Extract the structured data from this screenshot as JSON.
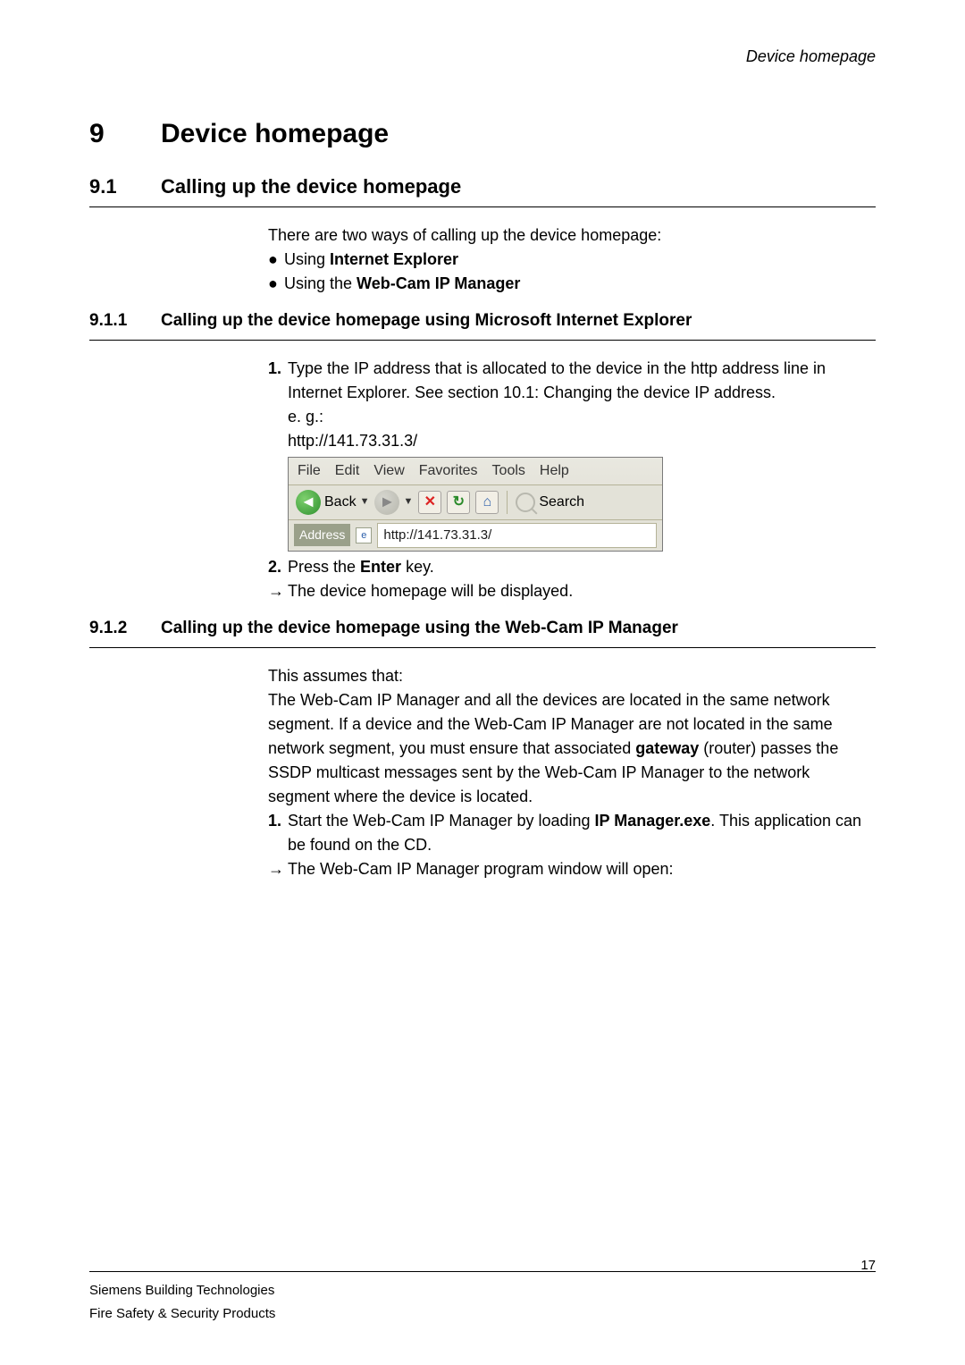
{
  "header": {
    "right": "Device homepage"
  },
  "chapter": {
    "num": "9",
    "title": "Device homepage"
  },
  "s91": {
    "num": "9.1",
    "title": "Calling up the device homepage",
    "intro": "There are two ways of calling up the device homepage:",
    "bullet1_pre": "Using ",
    "bullet1_bold": "Internet Explorer",
    "bullet2_pre": "Using the ",
    "bullet2_bold": "Web-Cam IP Manager"
  },
  "s911": {
    "num": "9.1.1",
    "title": "Calling up the device homepage using Microsoft Internet Explorer",
    "step1": "Type the IP address that is allocated to the device in the http address line in Internet Explorer. See section 10.1: Changing the device IP address.",
    "eg": "e. g.:",
    "url": "http://141.73.31.3/",
    "step2_pre": "Press the ",
    "step2_bold": "Enter",
    "step2_post": " key.",
    "result": "The device homepage will be displayed."
  },
  "browser": {
    "menu": {
      "file": "File",
      "edit": "Edit",
      "view": "View",
      "favorites": "Favorites",
      "tools": "Tools",
      "help": "Help"
    },
    "toolbar": {
      "back": "Back",
      "search": "Search"
    },
    "addr": {
      "label": "Address",
      "url": "http://141.73.31.3/"
    }
  },
  "s912": {
    "num": "9.1.2",
    "title": "Calling up the device homepage using the Web-Cam IP Manager",
    "assumes": "This assumes that:",
    "para_pre": "The Web-Cam IP Manager and all the devices are located in the same network segment. If a device and the Web-Cam IP Manager are not located in the same network segment, you must ensure that associated ",
    "para_bold": "gateway",
    "para_post": " (router) passes the SSDP multicast messages sent by the Web-Cam IP Manager to the network segment where the device is located.",
    "step1_pre": "Start the Web-Cam IP Manager by loading ",
    "step1_bold": "IP Manager.exe",
    "step1_post": ". This application can be found on the CD.",
    "result": "The Web-Cam IP Manager program window will open:"
  },
  "footer": {
    "page": "17",
    "line1": "Siemens Building Technologies",
    "line2": "Fire Safety & Security Products"
  }
}
